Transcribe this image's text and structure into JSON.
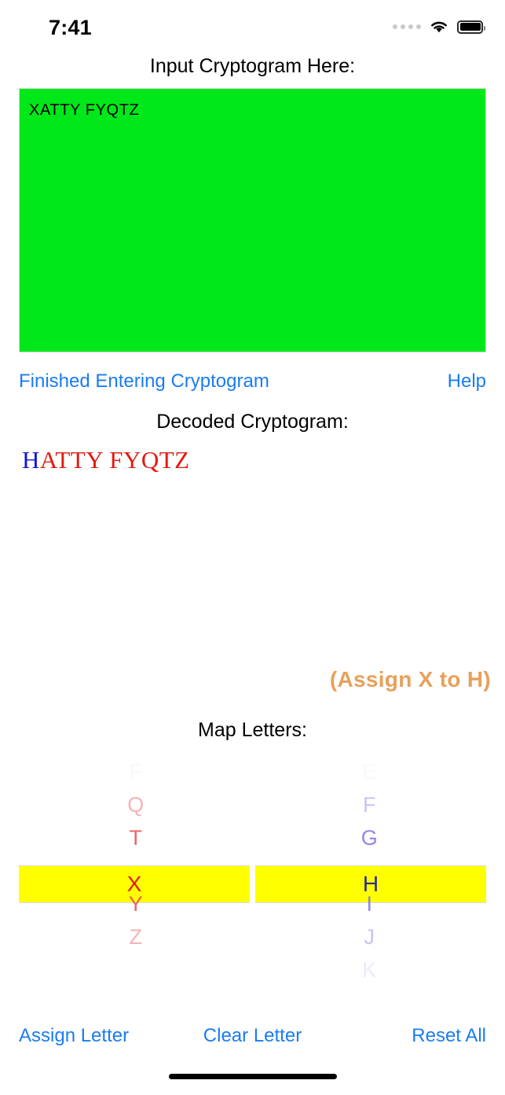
{
  "status_bar": {
    "time": "7:41",
    "cellular_icon": "signal-dots-icon",
    "wifi_icon": "wifi-icon",
    "battery_icon": "battery-full-icon"
  },
  "input_section": {
    "title": "Input Cryptogram Here:",
    "cryptogram_text": "XATTY FYQTZ",
    "placeholder": "",
    "background_color": "#00E819"
  },
  "actions_top": {
    "finished_label": "Finished Entering Cryptogram",
    "help_label": "Help",
    "link_color": "#1A7CF2"
  },
  "decoded_section": {
    "title": "Decoded Cryptogram:",
    "solved_text": "H",
    "unsolved_text": "ATTY FYQTZ",
    "solved_color": "#1414D2",
    "unsolved_color": "#E01B10"
  },
  "assign_hint": {
    "text": "(Assign X to H)",
    "color": "#E8A05C"
  },
  "map_section": {
    "title": "Map Letters:",
    "selected_cipher_letter": "X",
    "selected_plain_letter": "H",
    "highlight_color": "#FFFF00",
    "cipher_column": {
      "color": "#E84B4B",
      "above": [
        "F",
        "Q",
        "T"
      ],
      "selected": "X",
      "below": [
        "Y",
        "Z"
      ]
    },
    "plain_column": {
      "color": "#7B74E0",
      "above": [
        "E",
        "F",
        "G"
      ],
      "selected": "H",
      "below": [
        "I",
        "J",
        "K"
      ]
    }
  },
  "actions_bottom": {
    "assign_label": "Assign Letter",
    "clear_label": "Clear Letter",
    "reset_label": "Reset All"
  }
}
